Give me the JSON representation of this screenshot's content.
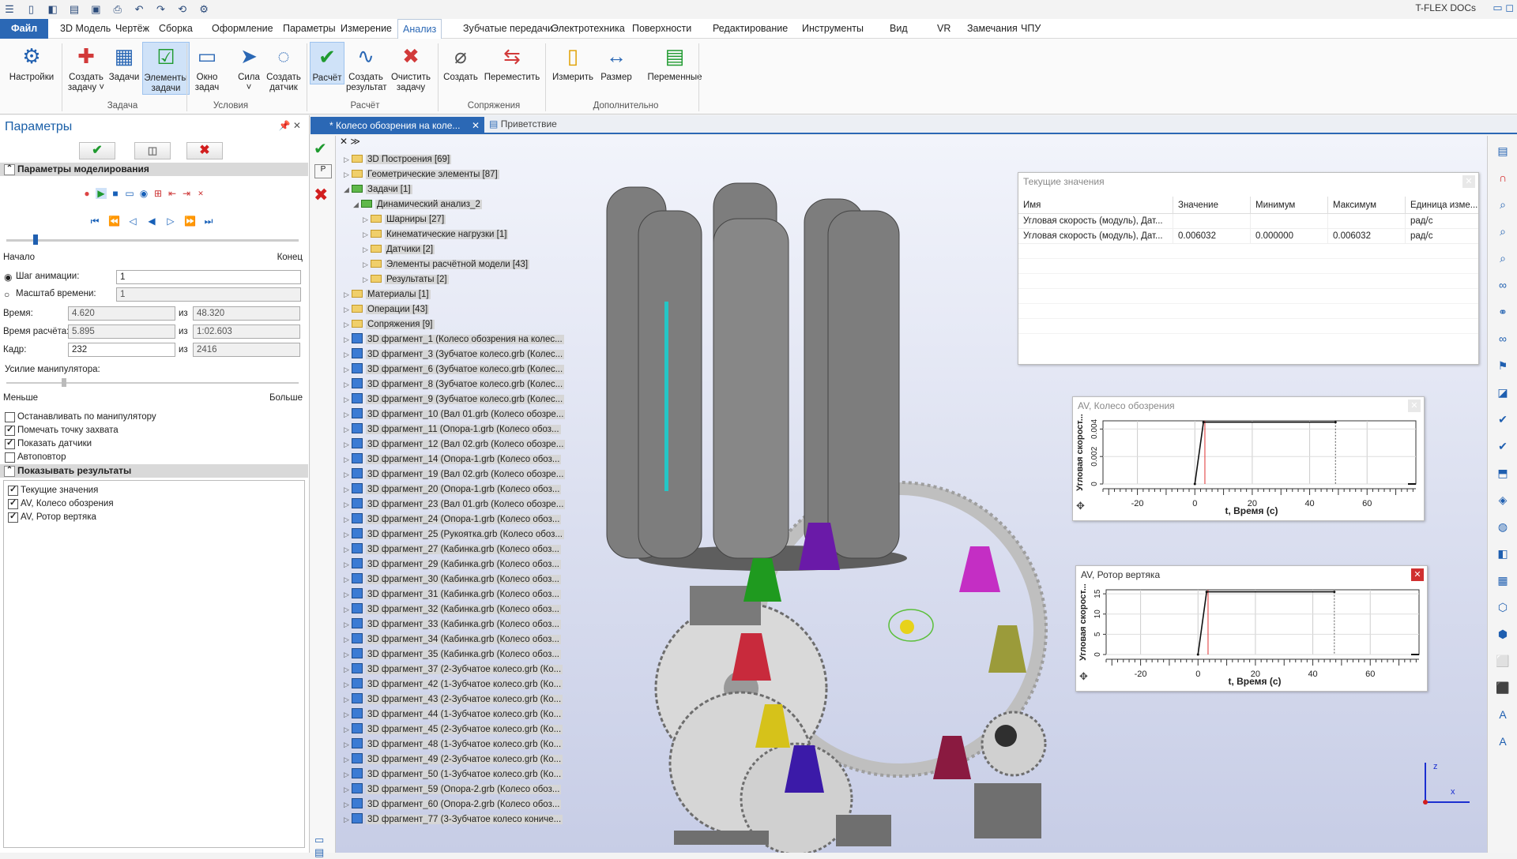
{
  "app": {
    "brand": "T-FLEX DOCs"
  },
  "menu": {
    "items": [
      "Файл",
      "3D Модель",
      "Чертёж",
      "Сборка",
      "Оформление",
      "Параметры",
      "Измерение",
      "Анализ",
      "Зубчатые передачи",
      "Электротехника",
      "Поверхности",
      "Редактирование",
      "Инструменты",
      "Вид",
      "VR",
      "Замечания",
      "ЧПУ"
    ],
    "active": "Анализ"
  },
  "ribbon": {
    "buttons": [
      {
        "label": "Настройки"
      },
      {
        "label": "Создать\nзадачу ˅"
      },
      {
        "label": "Задачи"
      },
      {
        "label": "Элементы\nзадачи"
      },
      {
        "label": "Окно\nзадач"
      },
      {
        "label": "Сила\n˅"
      },
      {
        "label": "Создать\nдатчик"
      },
      {
        "label": "Расчёт"
      },
      {
        "label": "Создать\nрезультат"
      },
      {
        "label": "Очистить\nзадачу"
      },
      {
        "label": "Создать"
      },
      {
        "label": "Переместить"
      },
      {
        "label": "Измерить"
      },
      {
        "label": "Размер"
      },
      {
        "label": "Переменные"
      }
    ],
    "groups": [
      "Задача",
      "Условия",
      "Расчёт",
      "Сопряжения",
      "Дополнительно"
    ]
  },
  "left_panel": {
    "title": "Параметры",
    "section_sim": "Параметры моделирования",
    "start_label": "Начало",
    "end_label": "Конец",
    "anim_step_label": "Шаг анимации:",
    "anim_step_value": "1",
    "time_scale_label": "Масштаб времени:",
    "time_scale_value": "1",
    "time_label": "Время:",
    "time_value": "4.620",
    "time_total": "48.320",
    "calc_time_label": "Время расчёта:",
    "calc_time_value": "5.895",
    "calc_time_total": "1:02.603",
    "frame_label": "Кадр:",
    "frame_value": "232",
    "frame_total": "2416",
    "of_label": "из",
    "force_label": "Усилие манипулятора:",
    "less_label": "Меньше",
    "more_label": "Больше",
    "checks": [
      {
        "label": "Останавливать по манипулятору",
        "checked": false
      },
      {
        "label": "Помечать точку захвата",
        "checked": true
      },
      {
        "label": "Показать датчики",
        "checked": true
      },
      {
        "label": "Автоповтор",
        "checked": false
      }
    ],
    "section_results": "Показывать результаты",
    "results": [
      {
        "label": "Текущие значения",
        "checked": true
      },
      {
        "label": "AV, Колесо обозрения",
        "checked": true
      },
      {
        "label": "AV, Ротор вертяка",
        "checked": true
      }
    ]
  },
  "tabs": {
    "doc": "* Колесо обозрения на коле...",
    "welcome": "Приветствие"
  },
  "tree": [
    {
      "t": "3D Построения [69]",
      "lvl": 0,
      "kind": "folder"
    },
    {
      "t": "Геометрические элементы [87]",
      "lvl": 0,
      "kind": "folder"
    },
    {
      "t": "Задачи [1]",
      "lvl": 0,
      "kind": "task",
      "open": true
    },
    {
      "t": "Динамический анализ_2",
      "lvl": 1,
      "kind": "task",
      "open": true
    },
    {
      "t": "Шарниры [27]",
      "lvl": 2,
      "kind": "folder"
    },
    {
      "t": "Кинематические нагрузки [1]",
      "lvl": 2,
      "kind": "folder"
    },
    {
      "t": "Датчики [2]",
      "lvl": 2,
      "kind": "folder"
    },
    {
      "t": "Элементы расчётной модели [43]",
      "lvl": 2,
      "kind": "folder"
    },
    {
      "t": "Результаты [2]",
      "lvl": 2,
      "kind": "folder"
    },
    {
      "t": "Материалы [1]",
      "lvl": 0,
      "kind": "folder"
    },
    {
      "t": "Операции [43]",
      "lvl": 0,
      "kind": "folder"
    },
    {
      "t": "Сопряжения [9]",
      "lvl": 0,
      "kind": "folder"
    },
    {
      "t": "3D фрагмент_1 (Колесо обозрения на колес...",
      "lvl": 0,
      "kind": "frag"
    },
    {
      "t": "3D фрагмент_3 (Зубчатое колесо.grb (Колес...",
      "lvl": 0,
      "kind": "frag"
    },
    {
      "t": "3D фрагмент_6 (Зубчатое колесо.grb (Колес...",
      "lvl": 0,
      "kind": "frag"
    },
    {
      "t": "3D фрагмент_8 (Зубчатое колесо.grb (Колес...",
      "lvl": 0,
      "kind": "frag"
    },
    {
      "t": "3D фрагмент_9 (Зубчатое колесо.grb (Колес...",
      "lvl": 0,
      "kind": "frag"
    },
    {
      "t": "3D фрагмент_10 (Вал 01.grb (Колесо обозре...",
      "lvl": 0,
      "kind": "frag"
    },
    {
      "t": "3D фрагмент_11 (Опора-1.grb (Колесо обоз...",
      "lvl": 0,
      "kind": "frag"
    },
    {
      "t": "3D фрагмент_12 (Вал 02.grb (Колесо обозре...",
      "lvl": 0,
      "kind": "frag"
    },
    {
      "t": "3D фрагмент_14 (Опора-1.grb (Колесо обоз...",
      "lvl": 0,
      "kind": "frag"
    },
    {
      "t": "3D фрагмент_19 (Вал 02.grb (Колесо обозре...",
      "lvl": 0,
      "kind": "frag"
    },
    {
      "t": "3D фрагмент_20 (Опора-1.grb (Колесо обоз...",
      "lvl": 0,
      "kind": "frag"
    },
    {
      "t": "3D фрагмент_23 (Вал 01.grb (Колесо обозре...",
      "lvl": 0,
      "kind": "frag"
    },
    {
      "t": "3D фрагмент_24 (Опора-1.grb (Колесо обоз...",
      "lvl": 0,
      "kind": "frag"
    },
    {
      "t": "3D фрагмент_25 (Рукоятка.grb (Колесо обоз...",
      "lvl": 0,
      "kind": "frag"
    },
    {
      "t": "3D фрагмент_27 (Кабинка.grb (Колесо обоз...",
      "lvl": 0,
      "kind": "frag"
    },
    {
      "t": "3D фрагмент_29 (Кабинка.grb (Колесо обоз...",
      "lvl": 0,
      "kind": "frag"
    },
    {
      "t": "3D фрагмент_30 (Кабинка.grb (Колесо обоз...",
      "lvl": 0,
      "kind": "frag"
    },
    {
      "t": "3D фрагмент_31 (Кабинка.grb (Колесо обоз...",
      "lvl": 0,
      "kind": "frag"
    },
    {
      "t": "3D фрагмент_32 (Кабинка.grb (Колесо обоз...",
      "lvl": 0,
      "kind": "frag"
    },
    {
      "t": "3D фрагмент_33 (Кабинка.grb (Колесо обоз...",
      "lvl": 0,
      "kind": "frag"
    },
    {
      "t": "3D фрагмент_34 (Кабинка.grb (Колесо обоз...",
      "lvl": 0,
      "kind": "frag"
    },
    {
      "t": "3D фрагмент_35 (Кабинка.grb (Колесо обоз...",
      "lvl": 0,
      "kind": "frag"
    },
    {
      "t": "3D фрагмент_37 (2-Зубчатое колесо.grb (Ко...",
      "lvl": 0,
      "kind": "frag"
    },
    {
      "t": "3D фрагмент_42 (1-Зубчатое колесо.grb (Ко...",
      "lvl": 0,
      "kind": "frag"
    },
    {
      "t": "3D фрагмент_43 (2-Зубчатое колесо.grb (Ко...",
      "lvl": 0,
      "kind": "frag"
    },
    {
      "t": "3D фрагмент_44 (1-Зубчатое колесо.grb (Ко...",
      "lvl": 0,
      "kind": "frag"
    },
    {
      "t": "3D фрагмент_45 (2-Зубчатое колесо.grb (Ко...",
      "lvl": 0,
      "kind": "frag"
    },
    {
      "t": "3D фрагмент_48 (1-Зубчатое колесо.grb (Ко...",
      "lvl": 0,
      "kind": "frag"
    },
    {
      "t": "3D фрагмент_49 (2-Зубчатое колесо.grb (Ко...",
      "lvl": 0,
      "kind": "frag"
    },
    {
      "t": "3D фрагмент_50 (1-Зубчатое колесо.grb (Ко...",
      "lvl": 0,
      "kind": "frag"
    },
    {
      "t": "3D фрагмент_59 (Опора-2.grb (Колесо обоз...",
      "lvl": 0,
      "kind": "frag"
    },
    {
      "t": "3D фрагмент_60 (Опора-2.grb (Колесо обоз...",
      "lvl": 0,
      "kind": "frag"
    },
    {
      "t": "3D фрагмент_77 (3-Зубчатое колесо кониче...",
      "lvl": 0,
      "kind": "frag"
    }
  ],
  "values_window": {
    "title": "Текущие значения",
    "headers": [
      "Имя",
      "Значение",
      "Минимум",
      "Максимум",
      "Единица изме..."
    ],
    "rows": [
      [
        "Угловая скорость (модуль), Дат...",
        "",
        "",
        "",
        "рад/с"
      ],
      [
        "Угловая скорость (модуль), Дат...",
        "0.006032",
        "0.000000",
        "0.006032",
        "рад/с"
      ]
    ]
  },
  "chart_data": [
    {
      "type": "line",
      "title": "AV, Колесо обозрения",
      "xlabel": "t, Время (с)",
      "ylabel": "Угловая скорост...",
      "xticks": [
        "-20",
        "0",
        "20",
        "40",
        "60"
      ],
      "yticks": [
        "0",
        "0.002",
        "0.004"
      ],
      "xlim": [
        -32,
        77
      ],
      "ylim": [
        0,
        0.0046
      ],
      "marker_x": 3.5,
      "series": [
        {
          "x": [
            0,
            3,
            49
          ],
          "y": [
            0,
            0.0045,
            0.0045
          ]
        }
      ]
    },
    {
      "type": "line",
      "title": "AV, Ротор вертяка",
      "xlabel": "t, Время (с)",
      "ylabel": "Угловая скорост...",
      "xticks": [
        "-20",
        "0",
        "20",
        "40",
        "60"
      ],
      "yticks": [
        "0",
        "5",
        "10",
        "15"
      ],
      "xlim": [
        -32,
        77
      ],
      "ylim": [
        0,
        16
      ],
      "marker_x": 3.5,
      "series": [
        {
          "x": [
            0,
            3,
            47.5
          ],
          "y": [
            0,
            15.5,
            15.5
          ]
        }
      ]
    }
  ],
  "colors": {
    "accent": "#2b68b5",
    "ok": "#1f9a2f",
    "cancel": "#d21e1e"
  }
}
